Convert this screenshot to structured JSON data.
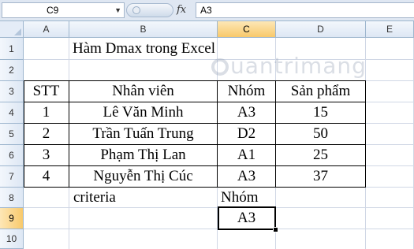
{
  "formula_bar": {
    "name_box": "C9",
    "fx_label": "fx",
    "formula": "A3"
  },
  "columns": [
    "A",
    "B",
    "C",
    "D",
    "E"
  ],
  "selected_column": "C",
  "rows": [
    "1",
    "2",
    "3",
    "4",
    "5",
    "6",
    "7",
    "8",
    "9",
    "10"
  ],
  "selected_row": "9",
  "sheet": {
    "title": "Hàm Dmax trong Excel",
    "table_headers": [
      "STT",
      "Nhân viên",
      "Nhóm",
      "Sản phẩm"
    ],
    "table_rows": [
      [
        "1",
        "Lê  Văn Minh",
        "A3",
        "15"
      ],
      [
        "2",
        "Trần Tuấn Trung",
        "D2",
        "50"
      ],
      [
        "3",
        "Phạm Thị Lan",
        "A1",
        "25"
      ],
      [
        "4",
        "Nguyễn Thị Cúc",
        "A3",
        "37"
      ]
    ],
    "criteria_label": "criteria",
    "criteria_header": "Nhóm",
    "criteria_value": "A3"
  },
  "watermark": "uantrimang"
}
